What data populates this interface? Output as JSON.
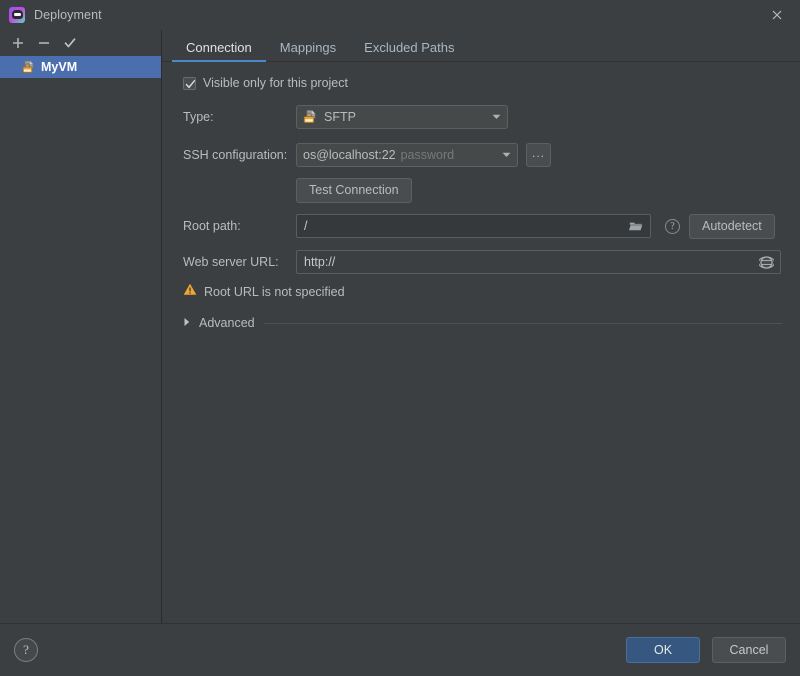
{
  "window": {
    "title": "Deployment",
    "app_icon": "pycharm-icon",
    "close_icon": "close-icon"
  },
  "left_panel": {
    "toolbar": [
      {
        "name": "add-server-button",
        "icon": "plus-icon",
        "label": "+"
      },
      {
        "name": "remove-server-button",
        "icon": "minus-icon",
        "label": "−"
      },
      {
        "name": "set-default-server-button",
        "icon": "check-icon",
        "label": "✓"
      }
    ],
    "servers": [
      {
        "label": "MyVM",
        "icon": "sftp-server-icon",
        "selected": true
      }
    ]
  },
  "tabs": [
    {
      "label": "Connection",
      "active": true
    },
    {
      "label": "Mappings",
      "active": false
    },
    {
      "label": "Excluded Paths",
      "active": false
    }
  ],
  "form": {
    "visible_only_checkbox": {
      "label": "Visible only for this project",
      "checked": true,
      "check_icon": "check-icon"
    },
    "type": {
      "label": "Type:",
      "value": "SFTP",
      "icon": "sftp-icon",
      "dropdown_icon": "chevron-down-icon"
    },
    "ssh_configuration": {
      "label": "SSH configuration:",
      "value": "os@localhost:22",
      "auth_hint": "password",
      "dropdown_icon": "chevron-down-icon",
      "browse_label": "...",
      "browse_name": "ssh-config-browse-button"
    },
    "test_connection": {
      "label": "Test Connection"
    },
    "root_path": {
      "label": "Root path:",
      "value": "/",
      "placeholder": "/",
      "folder_icon": "folder-icon",
      "help_icon": "question-mark-icon",
      "autodetect_label": "Autodetect"
    },
    "web_server_url": {
      "label": "Web server URL:",
      "value": "http://",
      "placeholder": "http://",
      "open_icon": "globe-icon"
    },
    "warning": {
      "icon": "warning-triangle-icon",
      "text": "Root URL is not specified"
    },
    "advanced": {
      "label": "Advanced",
      "expanded": false,
      "toggle_icon": "chevron-right-icon"
    }
  },
  "footer": {
    "help_label": "?",
    "help_icon": "question-mark-icon",
    "ok_label": "OK",
    "cancel_label": "Cancel"
  },
  "colors": {
    "background": "#3c3f41",
    "selection": "#4b6eaf",
    "accent": "#4a88c7",
    "ok_button": "#365880",
    "warning": "#f0a732",
    "field_background": "#35393b",
    "text": "#bbbbbb"
  }
}
